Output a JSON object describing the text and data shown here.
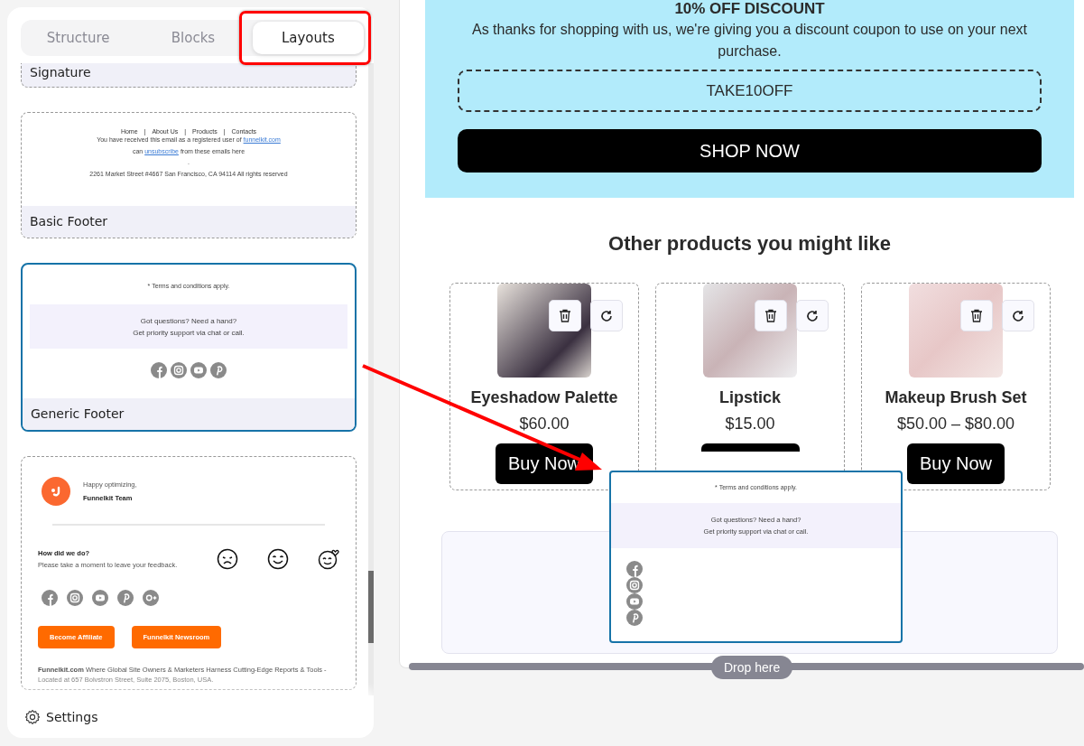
{
  "sidebar": {
    "tabs": [
      {
        "label": "Structure",
        "selected": false
      },
      {
        "label": "Blocks",
        "selected": false
      },
      {
        "label": "Layouts",
        "selected": true
      }
    ],
    "layouts": [
      {
        "kind": "signature",
        "name": "Signature",
        "selected": false
      },
      {
        "kind": "basic-footer",
        "name": "Basic Footer",
        "selected": false,
        "nav": [
          "Home",
          "About Us",
          "Products",
          "Contacts"
        ],
        "separator": "|",
        "registered_text": "You have received this email as a registered user of",
        "registered_link": "funnelkit.com",
        "unsub_before": "can",
        "unsub_link": "unsubscribe",
        "unsub_after": "from these emails here",
        "dot": ".",
        "address": "2261 Market Street #4667 San Francisco, CA 94114 All rights reserved"
      },
      {
        "kind": "generic-footer",
        "name": "Generic Footer",
        "selected": true,
        "terms": "* Terms and conditions apply.",
        "support": [
          "Got questions? Need a hand?",
          "Get priority support via chat or call."
        ]
      },
      {
        "kind": "team-footer",
        "selected": false,
        "greeting": "Happy optimizing,",
        "team": "Funnelkit Team",
        "question": "How did we do?",
        "prompt": "Please take a moment to leave your feedback.",
        "buttons": [
          "Become Affiliate",
          "Funnelkit Newsroom"
        ],
        "about": "**Funnelkit.com** Where Global Site Owners & Marketers Harness Cutting-Edge Reports & Tools -",
        "address": "Located at 657 Bolvstron Street, Suite 2075, Boston, USA."
      }
    ],
    "settings": "Settings"
  },
  "email": {
    "discount_title": "10% OFF DISCOUNT",
    "discount_text": "As thanks for shopping with us, we're giving you a discount coupon to use on your next purchase.",
    "coupon": "TAKE10OFF",
    "cta": "SHOP NOW",
    "products_title": "Other products you might like",
    "products": [
      {
        "name": "Eyeshadow Palette",
        "price": "$60.00",
        "button": "Buy Now"
      },
      {
        "name": "Lipstick",
        "price": "$15.00"
      },
      {
        "name": "Makeup Brush Set",
        "price": "$50.00 – $80.00",
        "button": "Buy Now"
      }
    ]
  },
  "drag_preview": {
    "terms": "* Terms and conditions apply.",
    "support": [
      "Got questions? Need a hand?",
      "Get priority support via chat or call."
    ]
  },
  "drop_hint": "Drop here"
}
